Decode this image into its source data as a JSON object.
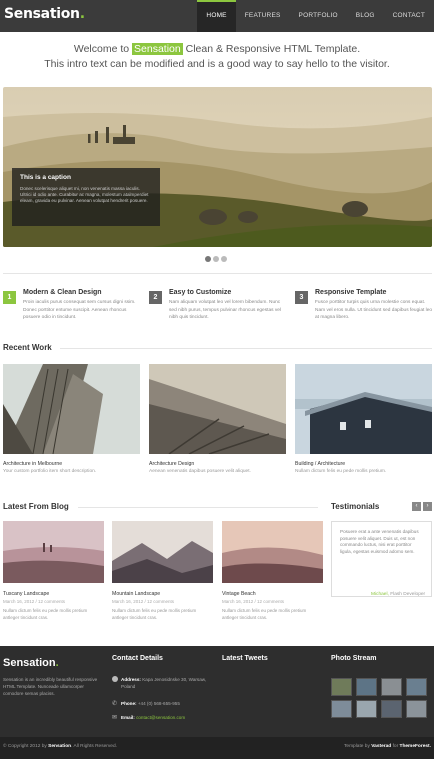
{
  "header": {
    "logo": "Sensation",
    "logo_dot": ".",
    "nav": [
      "HOME",
      "FEATURES",
      "PORTFOLIO",
      "BLOG",
      "CONTACT"
    ]
  },
  "intro": {
    "pre": "Welcome to",
    "highlight": "Sensation",
    "post": "Clean & Responsive HTML Template.",
    "line2": "This intro text can be modified and is a good way to say hello to the visitor."
  },
  "slider": {
    "caption_title": "This is a caption",
    "caption_text": "Donec scelerisque aliquet mi, non venenatis massa iaculis. Ultrici id odio ante. Curabitur ac magna, molestum atalmperdiet eleam, gravida eu pulvinar. Aenean volutpat hendrerit posuere."
  },
  "features": [
    {
      "num": "1",
      "title": "Modern & Clean Design",
      "text": "Proin iaculis purus consequat sem cursus digni ssim. Donec porttitor entume suscipit. Aenean rhoncus posuere odio in tincidunt.",
      "color": "#8cc63f"
    },
    {
      "num": "2",
      "title": "Easy to Customize",
      "text": "Nam aliquam volutpat leo vel lorem bibendum. Nunc sed nibh purus, tempus pulvinar rhoncus egestas vel nibh quis tincidunt.",
      "color": "#666666"
    },
    {
      "num": "3",
      "title": "Responsive Template",
      "text": "Fusce porttitor turpis quis urna molestie cons equat. Nam vel eros nulla. Ut tincidunt sed dapibus feugiat leo at magna libero.",
      "color": "#666666"
    }
  ],
  "recent_work": {
    "title": "Recent Work",
    "items": [
      {
        "title": "Architecture in Melbourne",
        "desc": "Your custom portfolio item short description."
      },
      {
        "title": "Architecture Design",
        "desc": "Aenean venenatis dapibus posuere velit aliquet."
      },
      {
        "title": "Building / Architecture",
        "desc": "Nullam dictum felis eu pede mollis pretium."
      }
    ]
  },
  "blog": {
    "title": "Latest From Blog",
    "items": [
      {
        "title": "Tuscany Landscape",
        "meta": "March 16, 2012 / 12 comments",
        "text": "Nullam dictum felis eu pede mollis pretium antleger tincidunt cras."
      },
      {
        "title": "Mountain Landscape",
        "meta": "March 16, 2012 / 12 comments",
        "text": "Nullam dictum felis eu pede mollis pretium antleger tincidunt cras."
      },
      {
        "title": "Vintage Beach",
        "meta": "March 16, 2012 / 12 comments",
        "text": "Nullam dictum felis eu pede mollis pretium antleger tincidunt cras."
      }
    ]
  },
  "testimonials": {
    "title": "Testimonials",
    "quote": "Posuere erat a ante venenatis dapibus posuere velit aliquet. Duis ut, est non commando luctus, nisi erat porttitor ligula, egestas euismod adomo sem.",
    "author": "Michael,",
    "role": "Flash Developer"
  },
  "footer": {
    "logo": "Sensation",
    "logo_dot": ".",
    "about": "Sensation is an incredibly beautiful responsive HTML Template. Nunceade ullamcorper comodore semas placiss.",
    "contact_title": "Contact Details",
    "address_label": "Address:",
    "address": "Kapa Jenosidnske 30, Warsaw, Poland",
    "phone_label": "Phone:",
    "phone": "+44 (0) 568-655-955",
    "email_label": "Email:",
    "email": "contact@sensation.com",
    "tweets_title": "Latest Tweets",
    "photos_title": "Photo Stream",
    "copyright": "© Copyright 2012 by",
    "copyright_brand": "Sensation",
    "copyright_tail": ". All Rights Reserved.",
    "credit": "Template by",
    "credit_author": "Vasterad",
    "credit_for": "for",
    "credit_market": "ThemeForest."
  },
  "colors": {
    "accent": "#8cc63f",
    "header": "#3b3b3b",
    "footer": "#2e2e2e"
  }
}
